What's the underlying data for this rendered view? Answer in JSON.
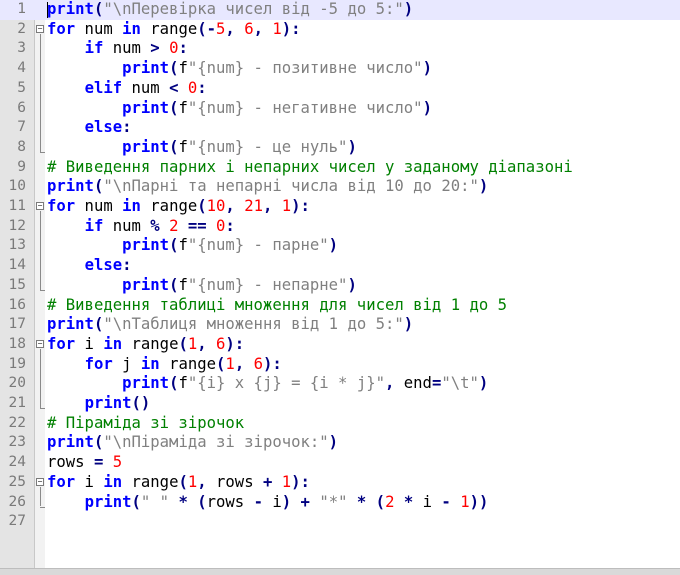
{
  "editor": {
    "current_line": 1,
    "lines": [
      {
        "n": "1",
        "tokens": [
          [
            "kw",
            "print"
          ],
          [
            "op",
            "("
          ],
          [
            "str",
            "\"\\nПеревірка чисел від -5 до 5:\""
          ],
          [
            "op",
            ")"
          ]
        ]
      },
      {
        "n": "2",
        "tokens": [
          [
            "kw",
            "for"
          ],
          [
            "plain",
            " num "
          ],
          [
            "kw",
            "in"
          ],
          [
            "plain",
            " range"
          ],
          [
            "op",
            "(-"
          ],
          [
            "num",
            "5"
          ],
          [
            "op",
            ", "
          ],
          [
            "num",
            "6"
          ],
          [
            "op",
            ", "
          ],
          [
            "num",
            "1"
          ],
          [
            "op",
            "):"
          ]
        ]
      },
      {
        "n": "3",
        "tokens": [
          [
            "plain",
            "    "
          ],
          [
            "kw",
            "if"
          ],
          [
            "plain",
            " num "
          ],
          [
            "op",
            ">"
          ],
          [
            "plain",
            " "
          ],
          [
            "num",
            "0"
          ],
          [
            "op",
            ":"
          ]
        ]
      },
      {
        "n": "4",
        "tokens": [
          [
            "plain",
            "        "
          ],
          [
            "kw",
            "print"
          ],
          [
            "op",
            "("
          ],
          [
            "plain",
            "f"
          ],
          [
            "str",
            "\"{num} - позитивне число\""
          ],
          [
            "op",
            ")"
          ]
        ]
      },
      {
        "n": "5",
        "tokens": [
          [
            "plain",
            "    "
          ],
          [
            "kw",
            "elif"
          ],
          [
            "plain",
            " num "
          ],
          [
            "op",
            "<"
          ],
          [
            "plain",
            " "
          ],
          [
            "num",
            "0"
          ],
          [
            "op",
            ":"
          ]
        ]
      },
      {
        "n": "6",
        "tokens": [
          [
            "plain",
            "        "
          ],
          [
            "kw",
            "print"
          ],
          [
            "op",
            "("
          ],
          [
            "plain",
            "f"
          ],
          [
            "str",
            "\"{num} - негативне число\""
          ],
          [
            "op",
            ")"
          ]
        ]
      },
      {
        "n": "7",
        "tokens": [
          [
            "plain",
            "    "
          ],
          [
            "kw",
            "else"
          ],
          [
            "op",
            ":"
          ]
        ]
      },
      {
        "n": "8",
        "tokens": [
          [
            "plain",
            "        "
          ],
          [
            "kw",
            "print"
          ],
          [
            "op",
            "("
          ],
          [
            "plain",
            "f"
          ],
          [
            "str",
            "\"{num} - це нуль\""
          ],
          [
            "op",
            ")"
          ]
        ]
      },
      {
        "n": "9",
        "tokens": [
          [
            "cmt",
            "# Виведення парних і непарних чисел у заданому діапазоні"
          ]
        ]
      },
      {
        "n": "10",
        "tokens": [
          [
            "kw",
            "print"
          ],
          [
            "op",
            "("
          ],
          [
            "str",
            "\"\\nПарні та непарні числа від 10 до 20:\""
          ],
          [
            "op",
            ")"
          ]
        ]
      },
      {
        "n": "11",
        "tokens": [
          [
            "kw",
            "for"
          ],
          [
            "plain",
            " num "
          ],
          [
            "kw",
            "in"
          ],
          [
            "plain",
            " range"
          ],
          [
            "op",
            "("
          ],
          [
            "num",
            "10"
          ],
          [
            "op",
            ", "
          ],
          [
            "num",
            "21"
          ],
          [
            "op",
            ", "
          ],
          [
            "num",
            "1"
          ],
          [
            "op",
            "):"
          ]
        ]
      },
      {
        "n": "12",
        "tokens": [
          [
            "plain",
            "    "
          ],
          [
            "kw",
            "if"
          ],
          [
            "plain",
            " num "
          ],
          [
            "op",
            "%"
          ],
          [
            "plain",
            " "
          ],
          [
            "num",
            "2"
          ],
          [
            "plain",
            " "
          ],
          [
            "op",
            "=="
          ],
          [
            "plain",
            " "
          ],
          [
            "num",
            "0"
          ],
          [
            "op",
            ":"
          ]
        ]
      },
      {
        "n": "13",
        "tokens": [
          [
            "plain",
            "        "
          ],
          [
            "kw",
            "print"
          ],
          [
            "op",
            "("
          ],
          [
            "plain",
            "f"
          ],
          [
            "str",
            "\"{num} - парне\""
          ],
          [
            "op",
            ")"
          ]
        ]
      },
      {
        "n": "14",
        "tokens": [
          [
            "plain",
            "    "
          ],
          [
            "kw",
            "else"
          ],
          [
            "op",
            ":"
          ]
        ]
      },
      {
        "n": "15",
        "tokens": [
          [
            "plain",
            "        "
          ],
          [
            "kw",
            "print"
          ],
          [
            "op",
            "("
          ],
          [
            "plain",
            "f"
          ],
          [
            "str",
            "\"{num} - непарне\""
          ],
          [
            "op",
            ")"
          ]
        ]
      },
      {
        "n": "16",
        "tokens": [
          [
            "cmt",
            "# Виведення таблиці множення для чисел від 1 до 5"
          ]
        ]
      },
      {
        "n": "17",
        "tokens": [
          [
            "kw",
            "print"
          ],
          [
            "op",
            "("
          ],
          [
            "str",
            "\"\\nТаблиця множення від 1 до 5:\""
          ],
          [
            "op",
            ")"
          ]
        ]
      },
      {
        "n": "18",
        "tokens": [
          [
            "kw",
            "for"
          ],
          [
            "plain",
            " i "
          ],
          [
            "kw",
            "in"
          ],
          [
            "plain",
            " range"
          ],
          [
            "op",
            "("
          ],
          [
            "num",
            "1"
          ],
          [
            "op",
            ", "
          ],
          [
            "num",
            "6"
          ],
          [
            "op",
            "):"
          ]
        ]
      },
      {
        "n": "19",
        "tokens": [
          [
            "plain",
            "    "
          ],
          [
            "kw",
            "for"
          ],
          [
            "plain",
            " j "
          ],
          [
            "kw",
            "in"
          ],
          [
            "plain",
            " range"
          ],
          [
            "op",
            "("
          ],
          [
            "num",
            "1"
          ],
          [
            "op",
            ", "
          ],
          [
            "num",
            "6"
          ],
          [
            "op",
            "):"
          ]
        ]
      },
      {
        "n": "20",
        "tokens": [
          [
            "plain",
            "        "
          ],
          [
            "kw",
            "print"
          ],
          [
            "op",
            "("
          ],
          [
            "plain",
            "f"
          ],
          [
            "str",
            "\"{i} x {j} = {i * j}\""
          ],
          [
            "op",
            ", "
          ],
          [
            "plain",
            "end"
          ],
          [
            "op",
            "="
          ],
          [
            "str",
            "\"\\t\""
          ],
          [
            "op",
            ")"
          ]
        ]
      },
      {
        "n": "21",
        "tokens": [
          [
            "plain",
            "    "
          ],
          [
            "kw",
            "print"
          ],
          [
            "op",
            "()"
          ]
        ]
      },
      {
        "n": "22",
        "tokens": [
          [
            "cmt",
            "# Піраміда зі зірочок"
          ]
        ]
      },
      {
        "n": "23",
        "tokens": [
          [
            "kw",
            "print"
          ],
          [
            "op",
            "("
          ],
          [
            "str",
            "\"\\nПіраміда зі зірочок:\""
          ],
          [
            "op",
            ")"
          ]
        ]
      },
      {
        "n": "24",
        "tokens": [
          [
            "plain",
            "rows "
          ],
          [
            "op",
            "="
          ],
          [
            "plain",
            " "
          ],
          [
            "num",
            "5"
          ]
        ]
      },
      {
        "n": "25",
        "tokens": [
          [
            "kw",
            "for"
          ],
          [
            "plain",
            " i "
          ],
          [
            "kw",
            "in"
          ],
          [
            "plain",
            " range"
          ],
          [
            "op",
            "("
          ],
          [
            "num",
            "1"
          ],
          [
            "op",
            ", "
          ],
          [
            "plain",
            "rows "
          ],
          [
            "op",
            "+"
          ],
          [
            "plain",
            " "
          ],
          [
            "num",
            "1"
          ],
          [
            "op",
            "):"
          ]
        ]
      },
      {
        "n": "26",
        "tokens": [
          [
            "plain",
            "    "
          ],
          [
            "kw",
            "print"
          ],
          [
            "op",
            "("
          ],
          [
            "str",
            "\" \""
          ],
          [
            "plain",
            " "
          ],
          [
            "op",
            "*"
          ],
          [
            "plain",
            " "
          ],
          [
            "op",
            "("
          ],
          [
            "plain",
            "rows "
          ],
          [
            "op",
            "-"
          ],
          [
            "plain",
            " i"
          ],
          [
            "op",
            ")"
          ],
          [
            "plain",
            " "
          ],
          [
            "op",
            "+"
          ],
          [
            "plain",
            " "
          ],
          [
            "str",
            "\"*\""
          ],
          [
            "plain",
            " "
          ],
          [
            "op",
            "*"
          ],
          [
            "plain",
            " "
          ],
          [
            "op",
            "("
          ],
          [
            "num",
            "2"
          ],
          [
            "plain",
            " "
          ],
          [
            "op",
            "*"
          ],
          [
            "plain",
            " i "
          ],
          [
            "op",
            "-"
          ],
          [
            "plain",
            " "
          ],
          [
            "num",
            "1"
          ],
          [
            "op",
            "))"
          ]
        ]
      },
      {
        "n": "27",
        "tokens": []
      }
    ],
    "fold_markers": [
      "2",
      "11",
      "18",
      "25"
    ]
  }
}
